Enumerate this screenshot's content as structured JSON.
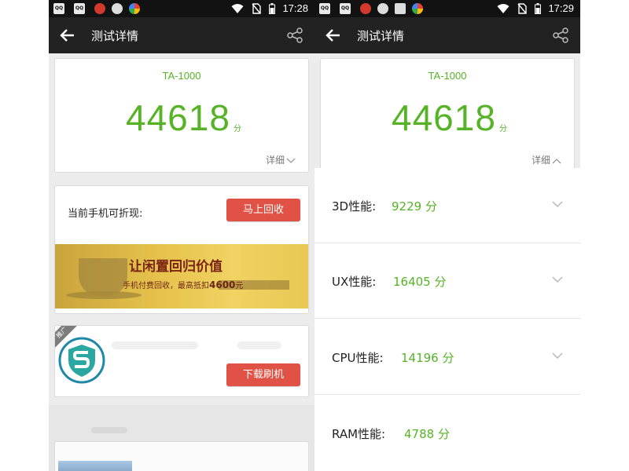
{
  "colors": {
    "accent_green": "#55b325",
    "button_red": "#e05245",
    "header_bg": "#222222",
    "status_bg": "#121212"
  },
  "icons": [
    "back-arrow-icon",
    "share-icon",
    "chevron-down-icon",
    "chevron-up-icon",
    "wifi-icon",
    "no-sim-icon",
    "battery-icon"
  ],
  "left": {
    "status": {
      "time": "17:28"
    },
    "header": {
      "title": "测试详情"
    },
    "score": {
      "device": "TA-1000",
      "value": "44618",
      "unit": "分",
      "detail_label": "详细"
    },
    "recycle": {
      "label": "当前手机可折现:",
      "button": "马上回收",
      "banner_title": "让闲置回归价值",
      "banner_sub_prefix": "手机付费回收，最高抵扣",
      "banner_sub_amount": "4600",
      "banner_sub_suffix": "元"
    },
    "promo": {
      "ribbon": "推广",
      "button": "下载刷机"
    }
  },
  "right": {
    "status": {
      "time": "17:29"
    },
    "header": {
      "title": "测试详情"
    },
    "score": {
      "device": "TA-1000",
      "value": "44618",
      "unit": "分",
      "detail_label": "详细"
    },
    "perf": [
      {
        "label": "3D性能:",
        "value": "9229 分"
      },
      {
        "label": "UX性能:",
        "value": "16405 分"
      },
      {
        "label": "CPU性能:",
        "value": "14196 分"
      },
      {
        "label": "RAM性能:",
        "value": "4788 分"
      }
    ]
  }
}
